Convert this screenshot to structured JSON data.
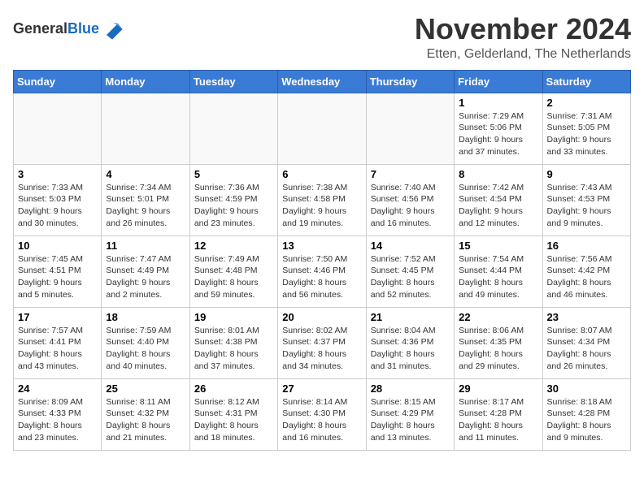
{
  "logo": {
    "general": "General",
    "blue": "Blue"
  },
  "title": "November 2024",
  "location": "Etten, Gelderland, The Netherlands",
  "days_of_week": [
    "Sunday",
    "Monday",
    "Tuesday",
    "Wednesday",
    "Thursday",
    "Friday",
    "Saturday"
  ],
  "weeks": [
    [
      {
        "day": "",
        "detail": ""
      },
      {
        "day": "",
        "detail": ""
      },
      {
        "day": "",
        "detail": ""
      },
      {
        "day": "",
        "detail": ""
      },
      {
        "day": "",
        "detail": ""
      },
      {
        "day": "1",
        "detail": "Sunrise: 7:29 AM\nSunset: 5:06 PM\nDaylight: 9 hours and 37 minutes."
      },
      {
        "day": "2",
        "detail": "Sunrise: 7:31 AM\nSunset: 5:05 PM\nDaylight: 9 hours and 33 minutes."
      }
    ],
    [
      {
        "day": "3",
        "detail": "Sunrise: 7:33 AM\nSunset: 5:03 PM\nDaylight: 9 hours and 30 minutes."
      },
      {
        "day": "4",
        "detail": "Sunrise: 7:34 AM\nSunset: 5:01 PM\nDaylight: 9 hours and 26 minutes."
      },
      {
        "day": "5",
        "detail": "Sunrise: 7:36 AM\nSunset: 4:59 PM\nDaylight: 9 hours and 23 minutes."
      },
      {
        "day": "6",
        "detail": "Sunrise: 7:38 AM\nSunset: 4:58 PM\nDaylight: 9 hours and 19 minutes."
      },
      {
        "day": "7",
        "detail": "Sunrise: 7:40 AM\nSunset: 4:56 PM\nDaylight: 9 hours and 16 minutes."
      },
      {
        "day": "8",
        "detail": "Sunrise: 7:42 AM\nSunset: 4:54 PM\nDaylight: 9 hours and 12 minutes."
      },
      {
        "day": "9",
        "detail": "Sunrise: 7:43 AM\nSunset: 4:53 PM\nDaylight: 9 hours and 9 minutes."
      }
    ],
    [
      {
        "day": "10",
        "detail": "Sunrise: 7:45 AM\nSunset: 4:51 PM\nDaylight: 9 hours and 5 minutes."
      },
      {
        "day": "11",
        "detail": "Sunrise: 7:47 AM\nSunset: 4:49 PM\nDaylight: 9 hours and 2 minutes."
      },
      {
        "day": "12",
        "detail": "Sunrise: 7:49 AM\nSunset: 4:48 PM\nDaylight: 8 hours and 59 minutes."
      },
      {
        "day": "13",
        "detail": "Sunrise: 7:50 AM\nSunset: 4:46 PM\nDaylight: 8 hours and 56 minutes."
      },
      {
        "day": "14",
        "detail": "Sunrise: 7:52 AM\nSunset: 4:45 PM\nDaylight: 8 hours and 52 minutes."
      },
      {
        "day": "15",
        "detail": "Sunrise: 7:54 AM\nSunset: 4:44 PM\nDaylight: 8 hours and 49 minutes."
      },
      {
        "day": "16",
        "detail": "Sunrise: 7:56 AM\nSunset: 4:42 PM\nDaylight: 8 hours and 46 minutes."
      }
    ],
    [
      {
        "day": "17",
        "detail": "Sunrise: 7:57 AM\nSunset: 4:41 PM\nDaylight: 8 hours and 43 minutes."
      },
      {
        "day": "18",
        "detail": "Sunrise: 7:59 AM\nSunset: 4:40 PM\nDaylight: 8 hours and 40 minutes."
      },
      {
        "day": "19",
        "detail": "Sunrise: 8:01 AM\nSunset: 4:38 PM\nDaylight: 8 hours and 37 minutes."
      },
      {
        "day": "20",
        "detail": "Sunrise: 8:02 AM\nSunset: 4:37 PM\nDaylight: 8 hours and 34 minutes."
      },
      {
        "day": "21",
        "detail": "Sunrise: 8:04 AM\nSunset: 4:36 PM\nDaylight: 8 hours and 31 minutes."
      },
      {
        "day": "22",
        "detail": "Sunrise: 8:06 AM\nSunset: 4:35 PM\nDaylight: 8 hours and 29 minutes."
      },
      {
        "day": "23",
        "detail": "Sunrise: 8:07 AM\nSunset: 4:34 PM\nDaylight: 8 hours and 26 minutes."
      }
    ],
    [
      {
        "day": "24",
        "detail": "Sunrise: 8:09 AM\nSunset: 4:33 PM\nDaylight: 8 hours and 23 minutes."
      },
      {
        "day": "25",
        "detail": "Sunrise: 8:11 AM\nSunset: 4:32 PM\nDaylight: 8 hours and 21 minutes."
      },
      {
        "day": "26",
        "detail": "Sunrise: 8:12 AM\nSunset: 4:31 PM\nDaylight: 8 hours and 18 minutes."
      },
      {
        "day": "27",
        "detail": "Sunrise: 8:14 AM\nSunset: 4:30 PM\nDaylight: 8 hours and 16 minutes."
      },
      {
        "day": "28",
        "detail": "Sunrise: 8:15 AM\nSunset: 4:29 PM\nDaylight: 8 hours and 13 minutes."
      },
      {
        "day": "29",
        "detail": "Sunrise: 8:17 AM\nSunset: 4:28 PM\nDaylight: 8 hours and 11 minutes."
      },
      {
        "day": "30",
        "detail": "Sunrise: 8:18 AM\nSunset: 4:28 PM\nDaylight: 8 hours and 9 minutes."
      }
    ]
  ]
}
